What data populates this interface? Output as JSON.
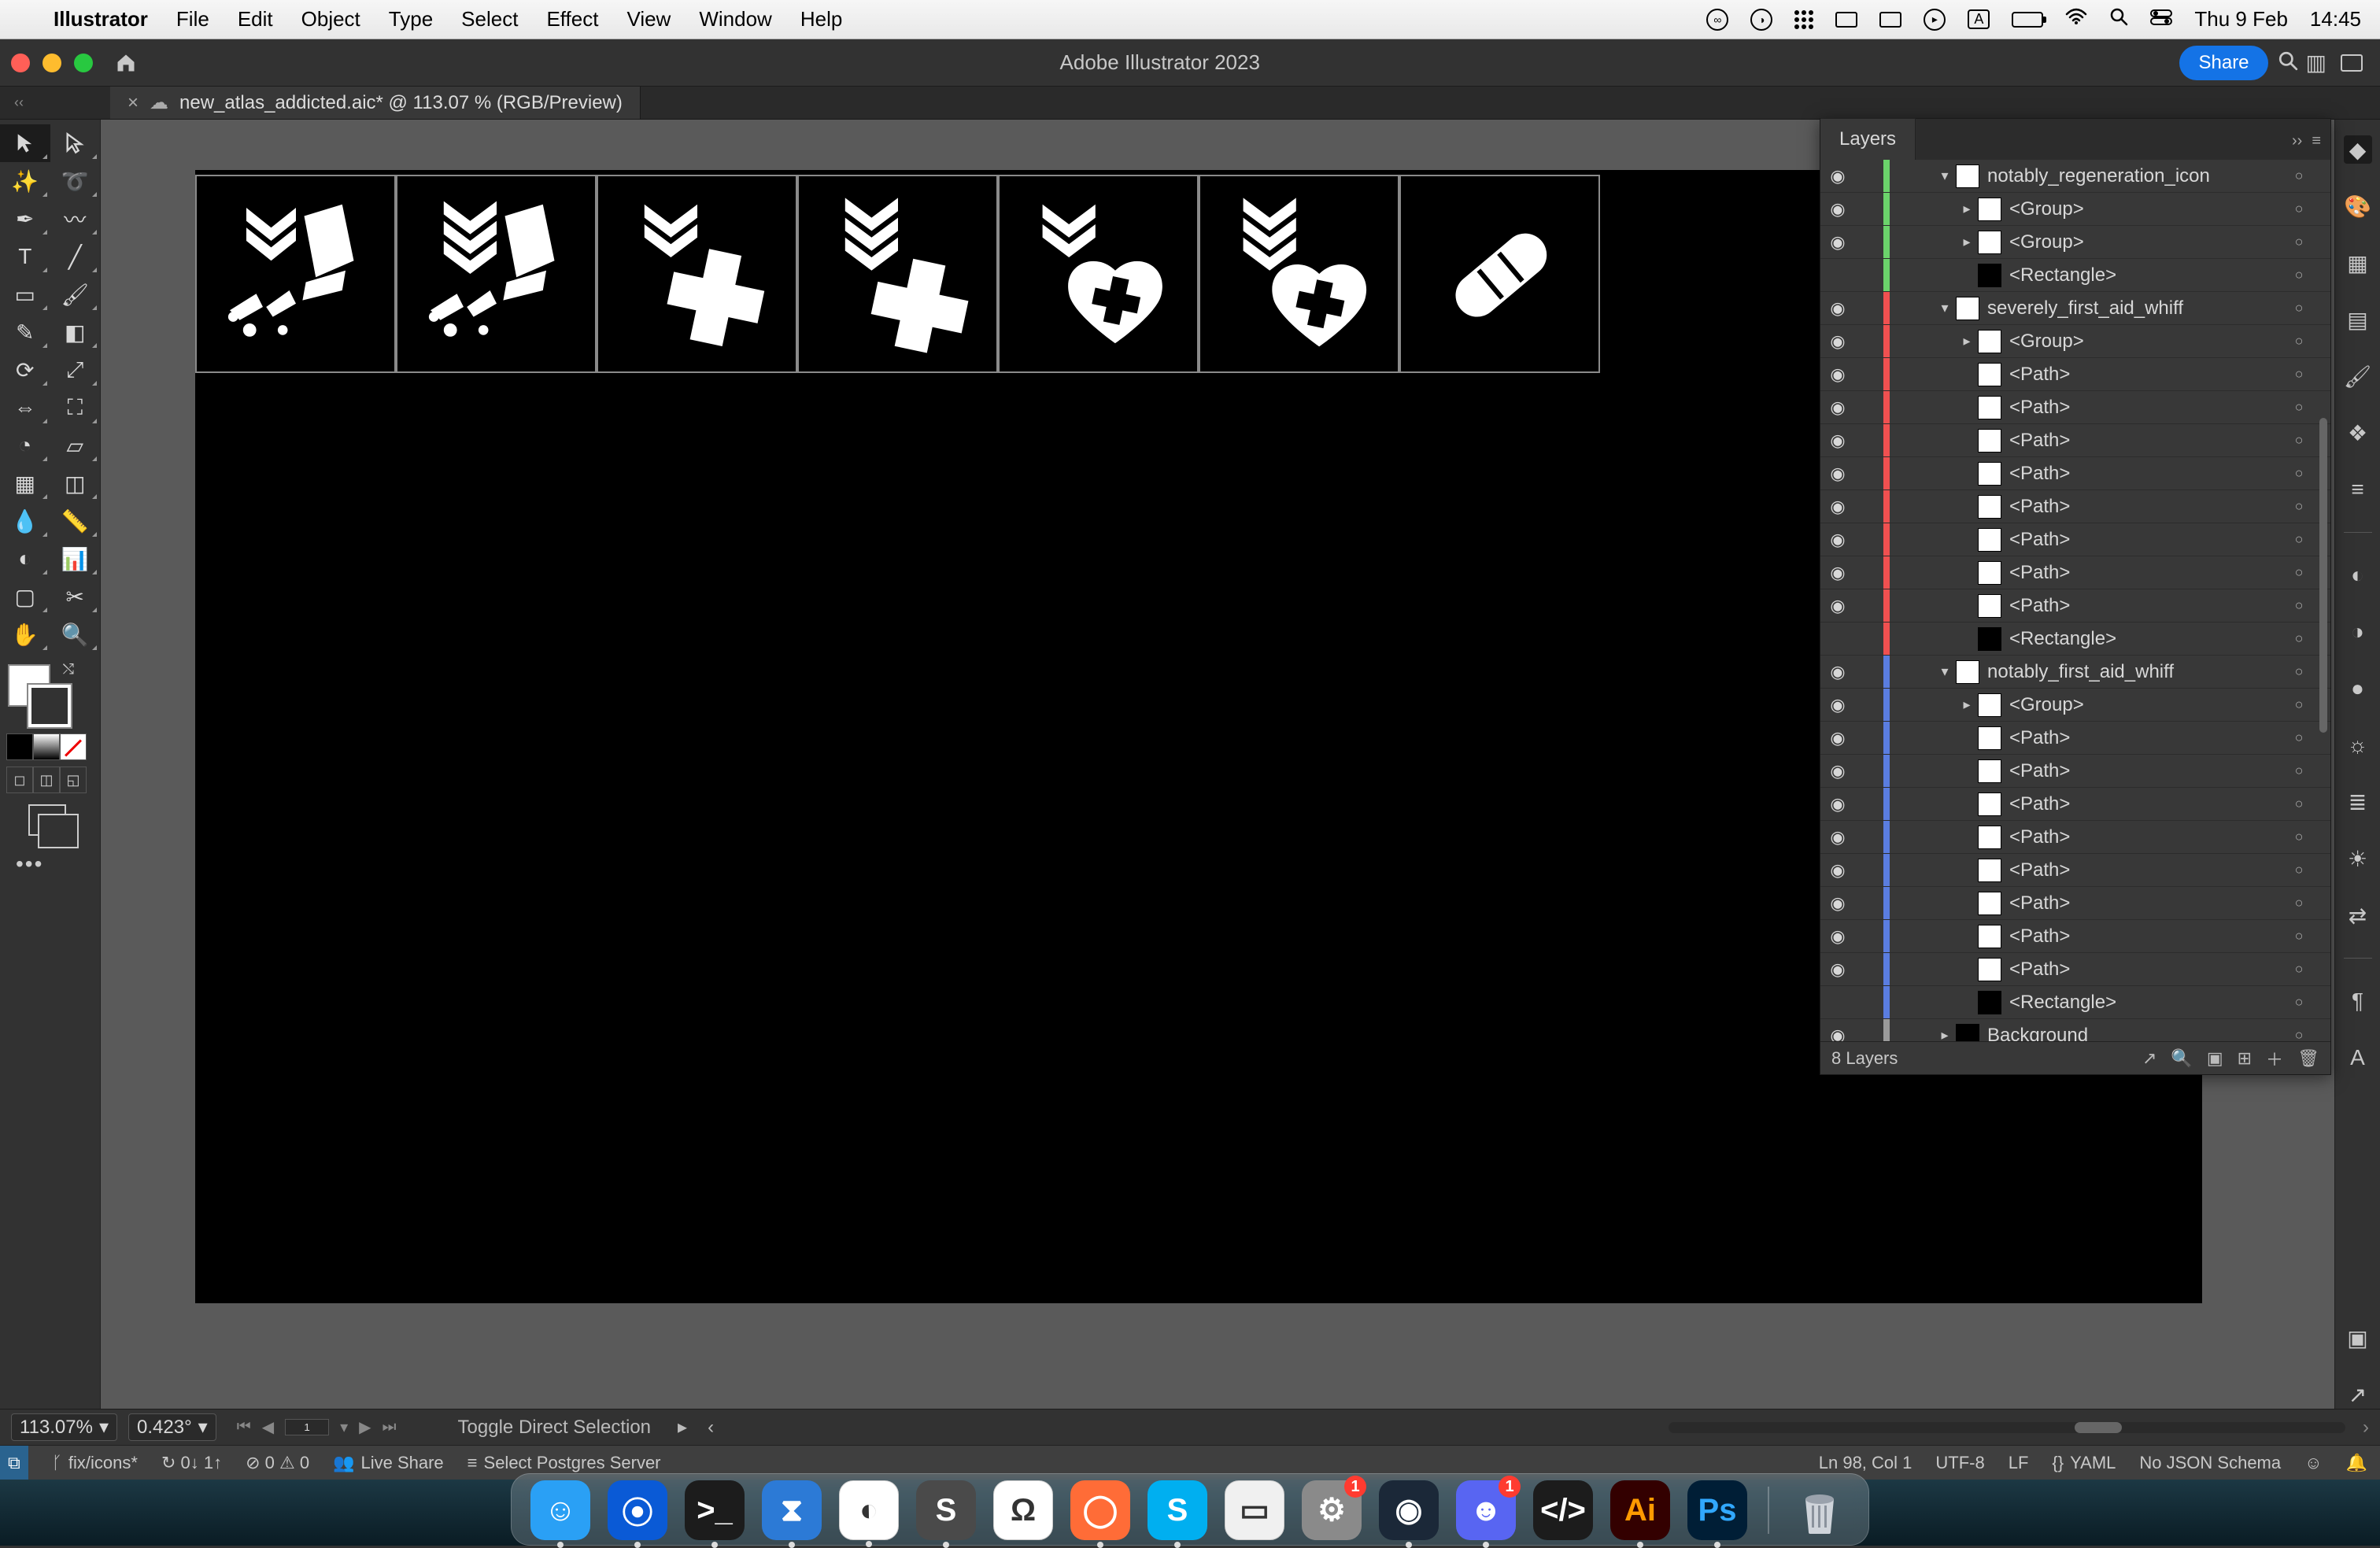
{
  "menubar": {
    "app_name": "Illustrator",
    "items": [
      "File",
      "Edit",
      "Object",
      "Type",
      "Select",
      "Effect",
      "View",
      "Window",
      "Help"
    ],
    "date": "Thu 9 Feb",
    "time": "14:45",
    "input_badge": "A"
  },
  "titlebar": {
    "app_title": "Adobe Illustrator 2023",
    "share_label": "Share"
  },
  "document_tab": {
    "close": "×",
    "label": "new_atlas_addicted.aic* @ 113.07 % (RGB/Preview)"
  },
  "status": {
    "zoom": "113.07%",
    "rotate": "0.423°",
    "artboard": "1",
    "hint": "Toggle Direct Selection"
  },
  "layers_panel": {
    "tab": "Layers",
    "footer_count": "8 Layers",
    "rows": [
      {
        "eye": true,
        "color": "green",
        "indent": 2,
        "twist": "down",
        "thumb": "white",
        "label": "notably_regeneration_icon"
      },
      {
        "eye": true,
        "color": "green",
        "indent": 3,
        "twist": "right",
        "thumb": "white",
        "label": "<Group>"
      },
      {
        "eye": true,
        "color": "green",
        "indent": 3,
        "twist": "right",
        "thumb": "white",
        "label": "<Group>"
      },
      {
        "eye": false,
        "color": "green",
        "indent": 3,
        "twist": "",
        "thumb": "black",
        "label": "<Rectangle>"
      },
      {
        "eye": true,
        "color": "red",
        "indent": 2,
        "twist": "down",
        "thumb": "white",
        "label": "severely_first_aid_whiff"
      },
      {
        "eye": true,
        "color": "red",
        "indent": 3,
        "twist": "right",
        "thumb": "white",
        "label": "<Group>"
      },
      {
        "eye": true,
        "color": "red",
        "indent": 3,
        "twist": "",
        "thumb": "white",
        "label": "<Path>"
      },
      {
        "eye": true,
        "color": "red",
        "indent": 3,
        "twist": "",
        "thumb": "white",
        "label": "<Path>"
      },
      {
        "eye": true,
        "color": "red",
        "indent": 3,
        "twist": "",
        "thumb": "white",
        "label": "<Path>"
      },
      {
        "eye": true,
        "color": "red",
        "indent": 3,
        "twist": "",
        "thumb": "white",
        "label": "<Path>"
      },
      {
        "eye": true,
        "color": "red",
        "indent": 3,
        "twist": "",
        "thumb": "white",
        "label": "<Path>"
      },
      {
        "eye": true,
        "color": "red",
        "indent": 3,
        "twist": "",
        "thumb": "white",
        "label": "<Path>"
      },
      {
        "eye": true,
        "color": "red",
        "indent": 3,
        "twist": "",
        "thumb": "white",
        "label": "<Path>"
      },
      {
        "eye": true,
        "color": "red",
        "indent": 3,
        "twist": "",
        "thumb": "white",
        "label": "<Path>"
      },
      {
        "eye": false,
        "color": "red",
        "indent": 3,
        "twist": "",
        "thumb": "black",
        "label": "<Rectangle>"
      },
      {
        "eye": true,
        "color": "blue",
        "indent": 2,
        "twist": "down",
        "thumb": "white",
        "label": "notably_first_aid_whiff"
      },
      {
        "eye": true,
        "color": "blue",
        "indent": 3,
        "twist": "right",
        "thumb": "white",
        "label": "<Group>"
      },
      {
        "eye": true,
        "color": "blue",
        "indent": 3,
        "twist": "",
        "thumb": "white",
        "label": "<Path>"
      },
      {
        "eye": true,
        "color": "blue",
        "indent": 3,
        "twist": "",
        "thumb": "white",
        "label": "<Path>"
      },
      {
        "eye": true,
        "color": "blue",
        "indent": 3,
        "twist": "",
        "thumb": "white",
        "label": "<Path>"
      },
      {
        "eye": true,
        "color": "blue",
        "indent": 3,
        "twist": "",
        "thumb": "white",
        "label": "<Path>"
      },
      {
        "eye": true,
        "color": "blue",
        "indent": 3,
        "twist": "",
        "thumb": "white",
        "label": "<Path>"
      },
      {
        "eye": true,
        "color": "blue",
        "indent": 3,
        "twist": "",
        "thumb": "white",
        "label": "<Path>"
      },
      {
        "eye": true,
        "color": "blue",
        "indent": 3,
        "twist": "",
        "thumb": "white",
        "label": "<Path>"
      },
      {
        "eye": true,
        "color": "blue",
        "indent": 3,
        "twist": "",
        "thumb": "white",
        "label": "<Path>"
      },
      {
        "eye": false,
        "color": "blue",
        "indent": 3,
        "twist": "",
        "thumb": "black",
        "label": "<Rectangle>"
      },
      {
        "eye": true,
        "color": "grey",
        "indent": 2,
        "twist": "right",
        "thumb": "black",
        "label": "Background"
      }
    ]
  },
  "code_status": {
    "branch": "fix/icons*",
    "sync": "↻ 0↓ 1↑",
    "errors": "⊘ 0 ⚠ 0",
    "live_share": "Live Share",
    "postgres": "Select Postgres Server",
    "cursor": "Ln 98, Col 1",
    "encoding": "UTF-8",
    "eol": "LF",
    "lang": "YAML",
    "schema": "No JSON Schema"
  },
  "dock": {
    "apps": [
      {
        "name": "finder",
        "color": "#2aa0f5",
        "glyph": "☺",
        "running": true
      },
      {
        "name": "sourcetree",
        "color": "#0a5ad6",
        "glyph": "⦿",
        "running": true
      },
      {
        "name": "terminal",
        "color": "#1c1c1c",
        "glyph": ">_",
        "running": true
      },
      {
        "name": "vscode",
        "color": "#2c7ad6",
        "glyph": "⧗",
        "running": true
      },
      {
        "name": "chrome",
        "color": "#ffffff",
        "glyph": "◐",
        "running": true
      },
      {
        "name": "sublime",
        "color": "#4a4a4a",
        "glyph": "S",
        "running": true
      },
      {
        "name": "mongodb",
        "color": "#ffffff",
        "glyph": "Ω",
        "running": false
      },
      {
        "name": "postman",
        "color": "#ff6c37",
        "glyph": "◯",
        "running": true
      },
      {
        "name": "skype",
        "color": "#00aff0",
        "glyph": "S",
        "running": true
      },
      {
        "name": "keynote",
        "color": "#f0f0f0",
        "glyph": "▭",
        "running": false
      },
      {
        "name": "settings",
        "color": "#8a8a8a",
        "glyph": "⚙",
        "running": false,
        "badge": "1"
      },
      {
        "name": "steam",
        "color": "#1b2838",
        "glyph": "◉",
        "running": true
      },
      {
        "name": "discord",
        "color": "#5865f2",
        "glyph": "☻",
        "running": true,
        "badge": "1"
      },
      {
        "name": "devtool",
        "color": "#1c1c1c",
        "glyph": "</>",
        "running": false
      },
      {
        "name": "illustrator",
        "color": "#330000",
        "glyph": "Ai",
        "running": true
      },
      {
        "name": "photoshop",
        "color": "#001e36",
        "glyph": "Ps",
        "running": true
      }
    ]
  }
}
